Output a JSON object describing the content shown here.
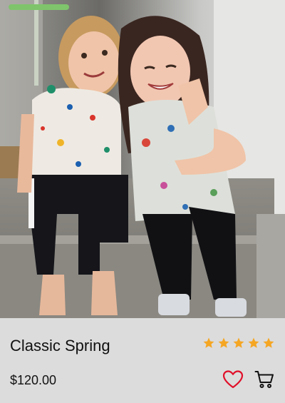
{
  "product": {
    "title": "Classic Spring",
    "price": "$120.00",
    "rating": 5,
    "rating_max": 5,
    "image_alt": "Two smiling children sitting on concrete steps",
    "star_color": "#f5a623",
    "heart_color": "#e0102a"
  },
  "icons": {
    "rating": "star-icon",
    "favorite": "heart-outline-icon",
    "cart": "shopping-cart-icon"
  }
}
